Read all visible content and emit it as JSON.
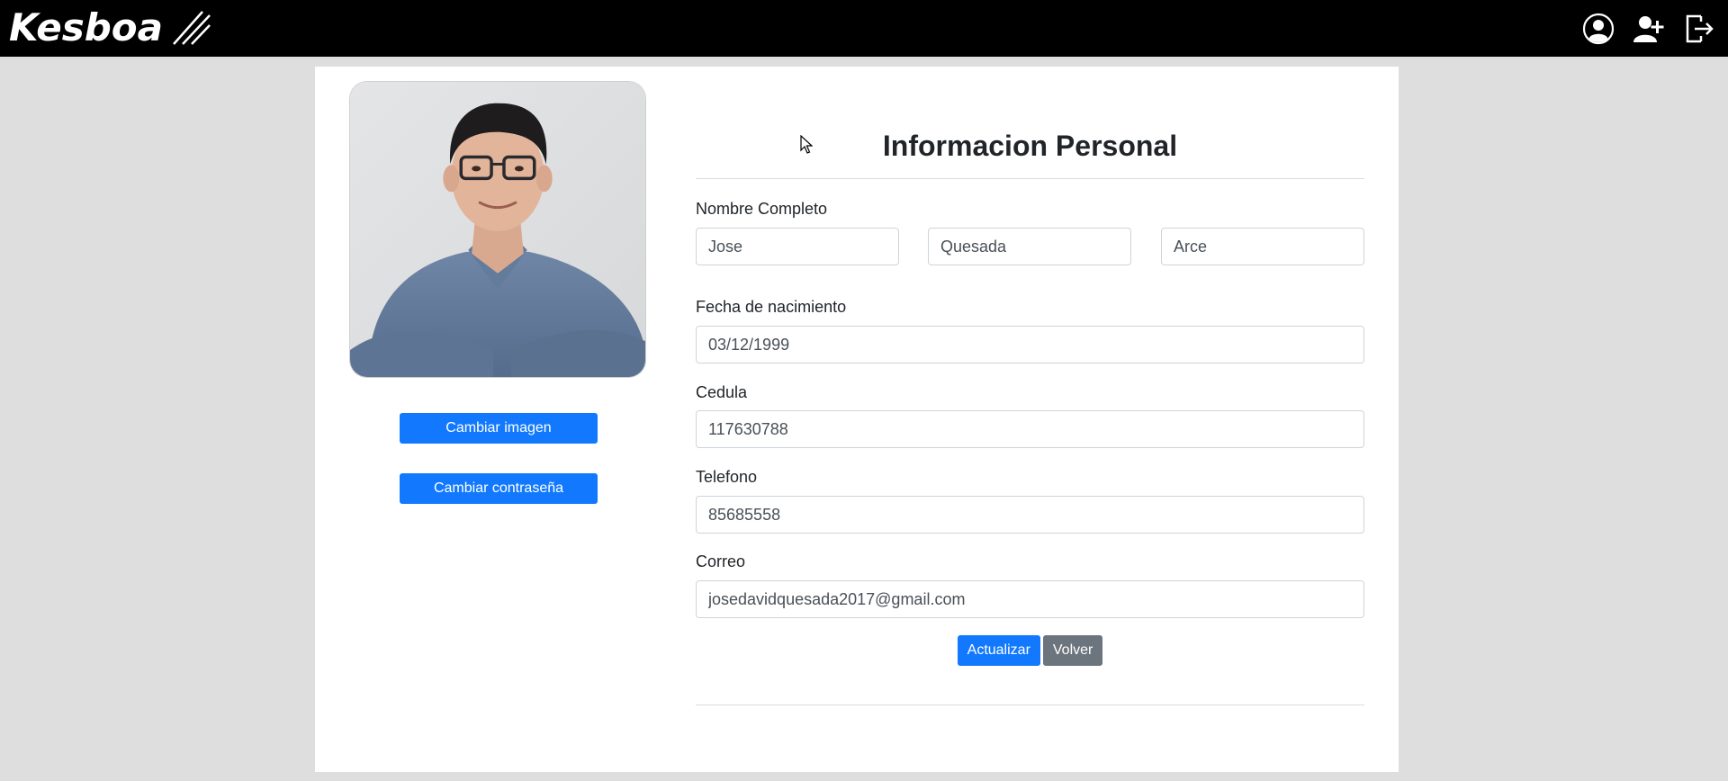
{
  "app": {
    "brand": "Kesboa"
  },
  "nav": {
    "icons": [
      "user-circle-icon",
      "add-user-icon",
      "logout-icon"
    ]
  },
  "profile": {
    "photo_alt": "",
    "change_image_label": "Cambiar imagen",
    "change_password_label": "Cambiar contraseña"
  },
  "form": {
    "title": "Informacion Personal",
    "full_name_label": "Nombre Completo",
    "first_name": "Jose",
    "last_name_1": "Quesada",
    "last_name_2": "Arce",
    "birth_date_label": "Fecha de nacimiento",
    "birth_date": "03/12/1999",
    "id_label": "Cedula",
    "id_value": "117630788",
    "phone_label": "Telefono",
    "phone_value": "85685558",
    "email_label": "Correo",
    "email_value": "josedavidquesada2017@gmail.com",
    "update_label": "Actualizar",
    "back_label": "Volver"
  },
  "colors": {
    "primary": "#1279ff",
    "secondary": "#6c757d",
    "navbar": "#000000",
    "page_bg": "#dedede"
  }
}
